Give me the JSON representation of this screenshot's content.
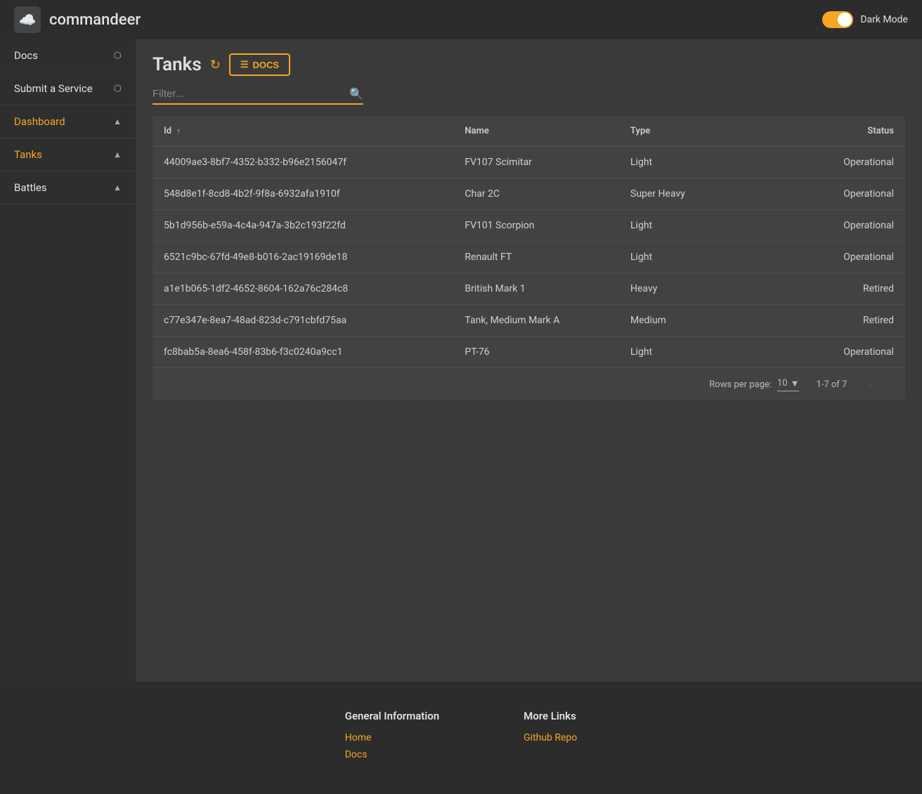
{
  "header": {
    "title": "commandeer",
    "dark_mode_label": "Dark Mode",
    "logo_emoji": "☁️"
  },
  "sidebar": {
    "items": [
      {
        "label": "Docs",
        "active": false,
        "has_external": true,
        "has_chevron": false
      },
      {
        "label": "Submit a Service",
        "active": false,
        "has_external": true,
        "has_chevron": false
      },
      {
        "label": "Dashboard",
        "active": true,
        "has_external": false,
        "has_chevron": true,
        "chevron": "▲"
      },
      {
        "label": "Tanks",
        "active": true,
        "has_external": false,
        "has_chevron": true,
        "chevron": "▲"
      },
      {
        "label": "Battles",
        "active": false,
        "has_external": false,
        "has_chevron": true,
        "chevron": "▲"
      }
    ]
  },
  "page": {
    "title": "Tanks",
    "docs_label": "DOCS",
    "filter_placeholder": "Filter..."
  },
  "table": {
    "columns": [
      {
        "label": "Id ↑",
        "key": "id"
      },
      {
        "label": "Name",
        "key": "name"
      },
      {
        "label": "Type",
        "key": "type"
      },
      {
        "label": "Status",
        "key": "status"
      }
    ],
    "rows": [
      {
        "id": "44009ae3-8bf7-4352-b332-b96e2156047f",
        "name": "FV107 Scimitar",
        "type": "Light",
        "status": "Operational"
      },
      {
        "id": "548d8e1f-8cd8-4b2f-9f8a-6932afa1910f",
        "name": "Char 2C",
        "type": "Super Heavy",
        "status": "Operational"
      },
      {
        "id": "5b1d956b-e59a-4c4a-947a-3b2c193f22fd",
        "name": "FV101 Scorpion",
        "type": "Light",
        "status": "Operational"
      },
      {
        "id": "6521c9bc-67fd-49e8-b016-2ac19169de18",
        "name": "Renault FT",
        "type": "Light",
        "status": "Operational"
      },
      {
        "id": "a1e1b065-1df2-4652-8604-162a76c284c8",
        "name": "British Mark 1",
        "type": "Heavy",
        "status": "Retired"
      },
      {
        "id": "c77e347e-8ea7-48ad-823d-c791cbfd75aa",
        "name": "Tank, Medium Mark A",
        "type": "Medium",
        "status": "Retired"
      },
      {
        "id": "fc8bab5a-8ea6-458f-83b6-f3c0240a9cc1",
        "name": "PT-76",
        "type": "Light",
        "status": "Operational"
      }
    ]
  },
  "pagination": {
    "rows_per_page_label": "Rows per page:",
    "rows_per_page_value": "10",
    "range_label": "1-7 of 7"
  },
  "footer": {
    "sections": [
      {
        "title": "General Information",
        "links": [
          "Home",
          "Docs"
        ]
      },
      {
        "title": "More Links",
        "links": [
          "Github Repo"
        ]
      }
    ]
  }
}
